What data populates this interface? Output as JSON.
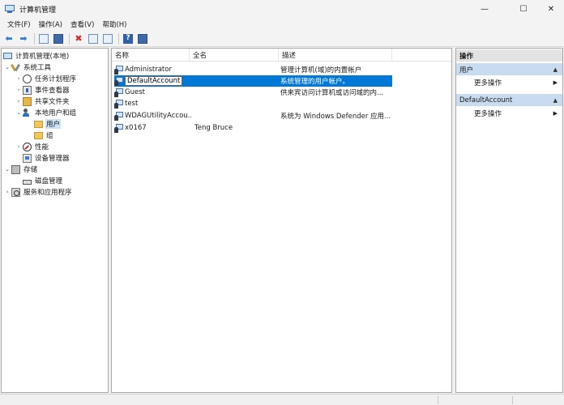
{
  "window": {
    "title": "计算机管理",
    "controls": {
      "minimize": "—",
      "maximize": "☐",
      "close": "✕"
    }
  },
  "menu": [
    "文件(F)",
    "操作(A)",
    "查看(V)",
    "帮助(H)"
  ],
  "toolbar": {
    "back_icon": "back-arrow-icon",
    "forward_icon": "forward-arrow-icon",
    "back": "⬅",
    "forward": "➡",
    "delete": "✖",
    "help": "?"
  },
  "tree": {
    "twisty_expanded": "⌄",
    "twisty_collapsed": "›",
    "items": [
      {
        "label": "计算机管理(本地)",
        "icon": "computer-icon"
      },
      {
        "label": "系统工具",
        "icon": "tools-icon"
      },
      {
        "label": "任务计划程序",
        "icon": "clock-icon"
      },
      {
        "label": "事件查看器",
        "icon": "event-viewer-icon"
      },
      {
        "label": "共享文件夹",
        "icon": "shared-folder-icon"
      },
      {
        "label": "本地用户和组",
        "icon": "users-icon"
      },
      {
        "label": "用户",
        "icon": "folder-icon"
      },
      {
        "label": "组",
        "icon": "folder-icon"
      },
      {
        "label": "性能",
        "icon": "performance-icon"
      },
      {
        "label": "设备管理器",
        "icon": "device-manager-icon"
      },
      {
        "label": "存储",
        "icon": "storage-icon"
      },
      {
        "label": "磁盘管理",
        "icon": "disk-icon"
      },
      {
        "label": "服务和应用程序",
        "icon": "services-icon"
      }
    ]
  },
  "list": {
    "columns": [
      "名称",
      "全名",
      "描述"
    ],
    "rows": [
      {
        "name": "Administrator",
        "fullname": "",
        "description": "管理计算机(域)的内置帐户"
      },
      {
        "name": "DefaultAccount",
        "fullname": "",
        "description": "系统管理的用户帐户。"
      },
      {
        "name": "Guest",
        "fullname": "",
        "description": "供来宾访问计算机或访问域的内..."
      },
      {
        "name": "test",
        "fullname": "",
        "description": ""
      },
      {
        "name": "WDAGUtilityAccou...",
        "fullname": "",
        "description": "系统为 Windows Defender 应用..."
      },
      {
        "name": "x0167",
        "fullname": "Teng Bruce",
        "description": ""
      }
    ]
  },
  "actions": {
    "header": "操作",
    "sections": [
      {
        "title": "用户",
        "item": "更多操作"
      },
      {
        "title": "DefaultAccount",
        "item": "更多操作"
      }
    ],
    "collapse_glyph": "▲",
    "more_glyph": "▶"
  }
}
